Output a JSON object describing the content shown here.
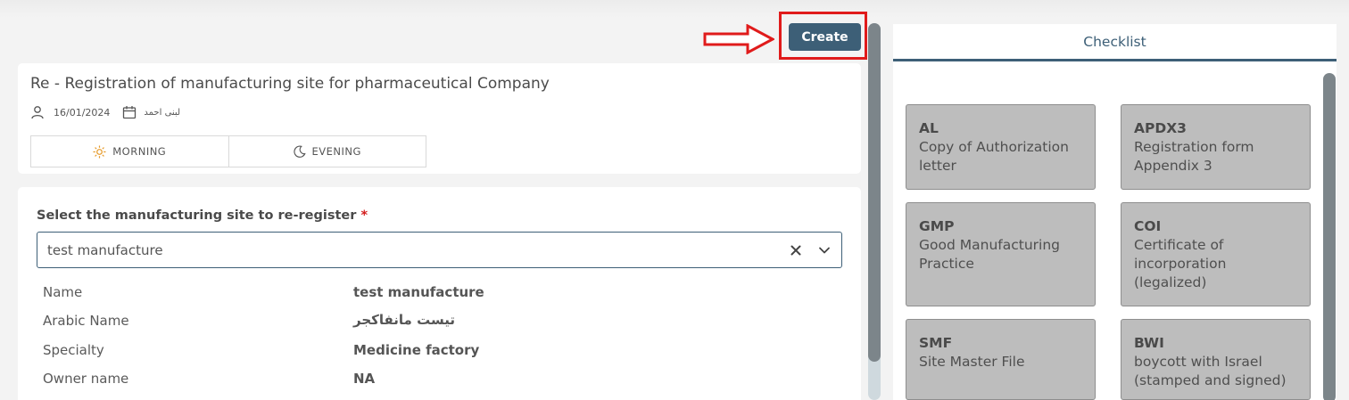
{
  "toolbar": {
    "create_label": "Create"
  },
  "request": {
    "title": "Re - Registration of manufacturing site for pharmaceutical Company",
    "date": "16/01/2024",
    "user_name": "لبنى احمد"
  },
  "shifts": [
    {
      "label": "MORNING",
      "icon": "sun-icon"
    },
    {
      "label": "EVENING",
      "icon": "moon-icon"
    }
  ],
  "form": {
    "site_label": "Select the manufacturing site to re-register",
    "required_mark": "*",
    "site_value": "test manufacture",
    "details": [
      {
        "label": "Name",
        "value": "test manufacture"
      },
      {
        "label": "Arabic Name",
        "value": "تيست مانفاكجر"
      },
      {
        "label": "Specialty",
        "value": "Medicine factory"
      },
      {
        "label": "Owner name",
        "value": "NA"
      }
    ]
  },
  "checklist": {
    "tab_label": "Checklist",
    "items": [
      {
        "code": "AL",
        "description": "Copy of Authorization letter"
      },
      {
        "code": "APDX3",
        "description": "Registration form Appendix 3"
      },
      {
        "code": "GMP",
        "description": "Good Manufacturing Practice"
      },
      {
        "code": "COI",
        "description": "Certificate of incorporation (legalized)"
      },
      {
        "code": "SMF",
        "description": "Site Master File"
      },
      {
        "code": "BWI",
        "description": "boycott with Israel (stamped and signed)"
      }
    ]
  },
  "colors": {
    "accent": "#3d5f77",
    "annotation": "#e01b1b",
    "required": "#d41c1c"
  }
}
